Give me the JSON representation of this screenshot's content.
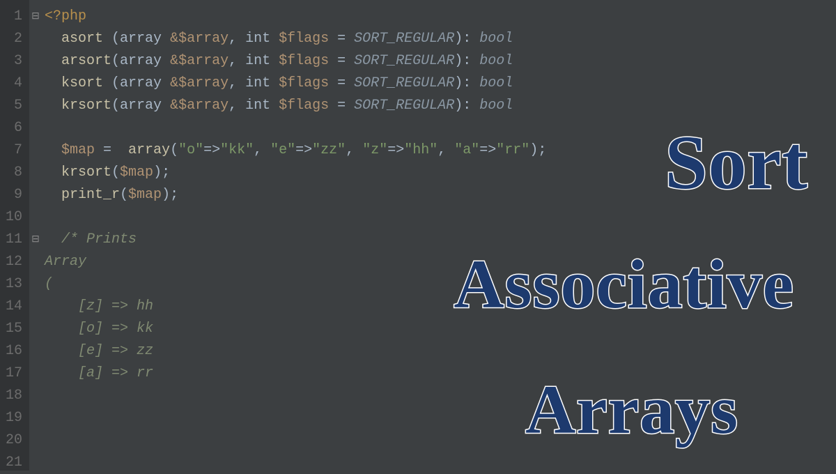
{
  "gutter": {
    "start": 1,
    "end": 21
  },
  "fold_markers": {
    "0": "⊟",
    "10": "⊟"
  },
  "code_lines": [
    [
      {
        "t": "<?php",
        "c": "c-phptag"
      }
    ],
    [
      {
        "t": "asort ",
        "c": "c-fn"
      },
      {
        "t": "(",
        "c": "c-op"
      },
      {
        "t": "array ",
        "c": "c-type"
      },
      {
        "t": "&",
        "c": "c-amp"
      },
      {
        "t": "$array",
        "c": "c-var"
      },
      {
        "t": ", ",
        "c": "c-op"
      },
      {
        "t": "int ",
        "c": "c-kw"
      },
      {
        "t": "$flags",
        "c": "c-var"
      },
      {
        "t": " = ",
        "c": "c-op"
      },
      {
        "t": "SORT_REGULAR",
        "c": "c-const"
      },
      {
        "t": ")",
        "c": "c-op"
      },
      {
        "t": ": ",
        "c": "c-op"
      },
      {
        "t": "bool",
        "c": "c-bool"
      }
    ],
    [
      {
        "t": "arsort",
        "c": "c-fn"
      },
      {
        "t": "(",
        "c": "c-op"
      },
      {
        "t": "array ",
        "c": "c-type"
      },
      {
        "t": "&",
        "c": "c-amp"
      },
      {
        "t": "$array",
        "c": "c-var"
      },
      {
        "t": ", ",
        "c": "c-op"
      },
      {
        "t": "int ",
        "c": "c-kw"
      },
      {
        "t": "$flags",
        "c": "c-var"
      },
      {
        "t": " = ",
        "c": "c-op"
      },
      {
        "t": "SORT_REGULAR",
        "c": "c-const"
      },
      {
        "t": ")",
        "c": "c-op"
      },
      {
        "t": ": ",
        "c": "c-op"
      },
      {
        "t": "bool",
        "c": "c-bool"
      }
    ],
    [
      {
        "t": "ksort ",
        "c": "c-fn"
      },
      {
        "t": "(",
        "c": "c-op"
      },
      {
        "t": "array ",
        "c": "c-type"
      },
      {
        "t": "&",
        "c": "c-amp"
      },
      {
        "t": "$array",
        "c": "c-var"
      },
      {
        "t": ", ",
        "c": "c-op"
      },
      {
        "t": "int ",
        "c": "c-kw"
      },
      {
        "t": "$flags",
        "c": "c-var"
      },
      {
        "t": " = ",
        "c": "c-op"
      },
      {
        "t": "SORT_REGULAR",
        "c": "c-const"
      },
      {
        "t": ")",
        "c": "c-op"
      },
      {
        "t": ": ",
        "c": "c-op"
      },
      {
        "t": "bool",
        "c": "c-bool"
      }
    ],
    [
      {
        "t": "krsort",
        "c": "c-fn"
      },
      {
        "t": "(",
        "c": "c-op"
      },
      {
        "t": "array ",
        "c": "c-type"
      },
      {
        "t": "&",
        "c": "c-amp"
      },
      {
        "t": "$array",
        "c": "c-var"
      },
      {
        "t": ", ",
        "c": "c-op"
      },
      {
        "t": "int ",
        "c": "c-kw"
      },
      {
        "t": "$flags",
        "c": "c-var"
      },
      {
        "t": " = ",
        "c": "c-op"
      },
      {
        "t": "SORT_REGULAR",
        "c": "c-const"
      },
      {
        "t": ")",
        "c": "c-op"
      },
      {
        "t": ": ",
        "c": "c-op"
      },
      {
        "t": "bool",
        "c": "c-bool"
      }
    ],
    [],
    [
      {
        "t": "$map",
        "c": "c-var"
      },
      {
        "t": " =  ",
        "c": "c-op"
      },
      {
        "t": "array",
        "c": "c-fn"
      },
      {
        "t": "(",
        "c": "c-op"
      },
      {
        "t": "\"o\"",
        "c": "c-str"
      },
      {
        "t": "=>",
        "c": "c-op"
      },
      {
        "t": "\"kk\"",
        "c": "c-str"
      },
      {
        "t": ", ",
        "c": "c-op"
      },
      {
        "t": "\"e\"",
        "c": "c-str"
      },
      {
        "t": "=>",
        "c": "c-op"
      },
      {
        "t": "\"zz\"",
        "c": "c-str"
      },
      {
        "t": ", ",
        "c": "c-op"
      },
      {
        "t": "\"z\"",
        "c": "c-str"
      },
      {
        "t": "=>",
        "c": "c-op"
      },
      {
        "t": "\"hh\"",
        "c": "c-str"
      },
      {
        "t": ", ",
        "c": "c-op"
      },
      {
        "t": "\"a\"",
        "c": "c-str"
      },
      {
        "t": "=>",
        "c": "c-op"
      },
      {
        "t": "\"rr\"",
        "c": "c-str"
      },
      {
        "t": ");",
        "c": "c-op"
      }
    ],
    [
      {
        "t": "krsort",
        "c": "c-fn"
      },
      {
        "t": "(",
        "c": "c-op"
      },
      {
        "t": "$map",
        "c": "c-var"
      },
      {
        "t": ");",
        "c": "c-op"
      }
    ],
    [
      {
        "t": "print_r",
        "c": "c-fn"
      },
      {
        "t": "(",
        "c": "c-op"
      },
      {
        "t": "$map",
        "c": "c-var"
      },
      {
        "t": ");",
        "c": "c-op"
      }
    ],
    [],
    [
      {
        "t": "/* Prints",
        "c": "c-cmt"
      }
    ],
    [
      {
        "t": "Array",
        "c": "c-cmt",
        "noindent": true
      }
    ],
    [
      {
        "t": "(",
        "c": "c-cmt",
        "noindent": true
      }
    ],
    [
      {
        "t": "    [z] => hh",
        "c": "c-cmt",
        "noindent": true
      }
    ],
    [
      {
        "t": "    [o] => kk",
        "c": "c-cmt",
        "noindent": true
      }
    ],
    [
      {
        "t": "    [e] => zz",
        "c": "c-cmt",
        "noindent": true
      }
    ],
    [
      {
        "t": "    [a] => rr",
        "c": "c-cmt",
        "noindent": true
      }
    ],
    [],
    [],
    [],
    []
  ],
  "overlay": {
    "line1": "Sort",
    "line2": "Associative",
    "line3": "Arrays"
  }
}
